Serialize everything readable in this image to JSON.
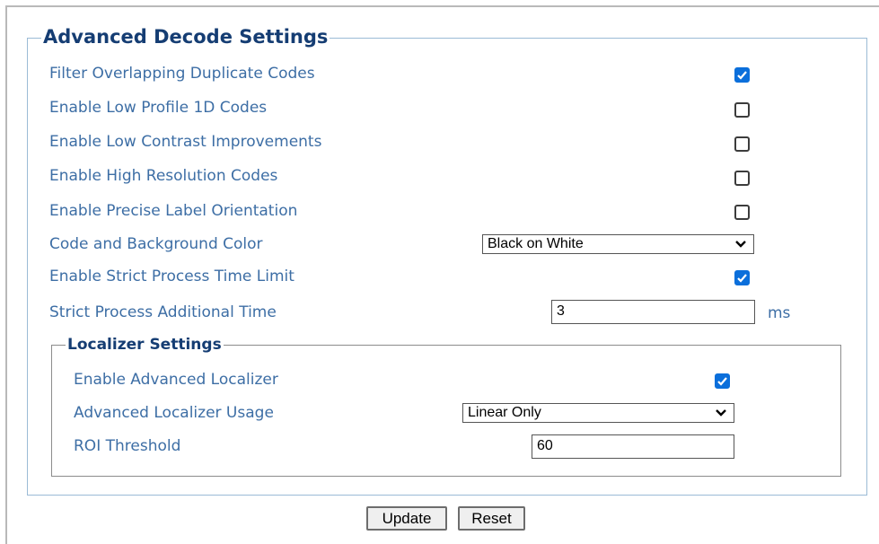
{
  "advanced_decode": {
    "title": "Advanced Decode Settings",
    "filter_overlapping": {
      "label": "Filter Overlapping Duplicate Codes",
      "checked": true
    },
    "low_profile_1d": {
      "label": "Enable Low Profile 1D Codes",
      "checked": false
    },
    "low_contrast": {
      "label": "Enable Low Contrast Improvements",
      "checked": false
    },
    "high_resolution": {
      "label": "Enable High Resolution Codes",
      "checked": false
    },
    "precise_orientation": {
      "label": "Enable Precise Label Orientation",
      "checked": false
    },
    "code_background_color": {
      "label": "Code and Background Color",
      "selected": "Black on White"
    },
    "strict_time_limit": {
      "label": "Enable Strict Process Time Limit",
      "checked": true
    },
    "strict_additional_time": {
      "label": "Strict Process Additional Time",
      "value": "3",
      "unit": "ms"
    }
  },
  "localizer": {
    "title": "Localizer Settings",
    "enable_advanced": {
      "label": "Enable Advanced Localizer",
      "checked": true
    },
    "usage": {
      "label": "Advanced Localizer Usage",
      "selected": "Linear Only"
    },
    "roi_threshold": {
      "label": "ROI Threshold",
      "value": "60"
    }
  },
  "buttons": {
    "update": "Update",
    "reset": "Reset"
  },
  "colors": {
    "label": "#3d6ea5",
    "heading": "#153d73",
    "checkbox_checked": "#0b6fdb",
    "fieldset_border": "#9bbbd6"
  },
  "icons": {
    "checkbox_check": "check-icon",
    "select_arrow": "chevron-down-icon"
  }
}
